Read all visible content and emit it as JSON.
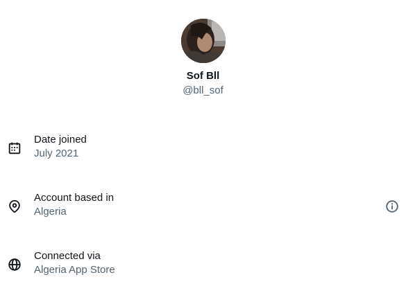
{
  "profile": {
    "display_name": "Sof Bll",
    "handle": "@bll_sof"
  },
  "details": {
    "date_joined": {
      "label": "Date joined",
      "value": "July 2021",
      "icon": "calendar-icon"
    },
    "account_based_in": {
      "label": "Account based in",
      "value": "Algeria",
      "icon": "location-pin-icon",
      "info_icon": "info-icon"
    },
    "connected_via": {
      "label": "Connected via",
      "value": "Algeria App Store",
      "icon": "globe-icon"
    }
  },
  "colors": {
    "primary_text": "#0f1419",
    "secondary_text": "#536471",
    "background": "#ffffff"
  }
}
